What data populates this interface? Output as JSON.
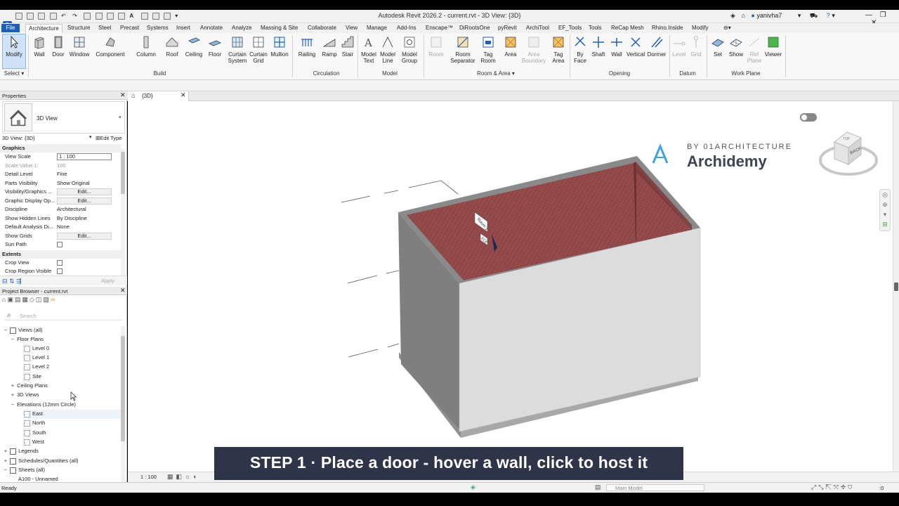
{
  "app": {
    "logo_letter": "R",
    "title": "Autodesk Revit 2026.2 - current.rvt - 3D View: {3D}",
    "user": "yanivha7"
  },
  "menu": {
    "file": "File",
    "tabs": [
      "Architecture",
      "Structure",
      "Steel",
      "Precast",
      "Systems",
      "Insert",
      "Annotate",
      "Analyze",
      "Massing & Site",
      "Collaborate",
      "View",
      "Manage",
      "Add-Ins",
      "Enscape™",
      "DiRootsOne",
      "pyRevit",
      "ArchiTool",
      "EF_Tools",
      "Tools",
      "ReCap Mesh",
      "Rhino.Inside",
      "Modify"
    ],
    "active_tab": "Architecture"
  },
  "ribbon": {
    "select": {
      "modify": "Modify",
      "panel": "Select ▾"
    },
    "build": {
      "items": [
        "Wall",
        "Door",
        "Window",
        "Component",
        "Column",
        "Roof",
        "Ceiling",
        "Floor"
      ],
      "curtain_system": [
        "Curtain",
        "System"
      ],
      "curtain_grid": [
        "Curtain",
        "Grid"
      ],
      "mullion": "Mullion",
      "panel": "Build"
    },
    "circulation": {
      "items": [
        "Railing",
        "Ramp",
        "Stair"
      ],
      "panel": "Circulation"
    },
    "model": {
      "model_text": [
        "Model",
        "Text"
      ],
      "model_line": [
        "Model",
        "Line"
      ],
      "model_group": [
        "Model",
        "Group"
      ],
      "panel": "Model"
    },
    "room_area": {
      "room": "Room",
      "room_separator": [
        "Room",
        "Separator"
      ],
      "tag_room": [
        "Tag",
        "Room"
      ],
      "area": "Area",
      "area_boundary": [
        "Area",
        "Boundary"
      ],
      "tag_area": [
        "Tag",
        "Area"
      ],
      "panel": "Room & Area ▾"
    },
    "opening": {
      "by_face": [
        "By",
        "Face"
      ],
      "items": [
        "Shaft",
        "Wall",
        "Vertical",
        "Dormer"
      ],
      "panel": "Opening"
    },
    "datum": {
      "items": [
        "Level",
        "Grid"
      ],
      "panel": "Datum"
    },
    "work_plane": {
      "items": [
        "Set",
        "Show"
      ],
      "ref_plane": [
        "Ref",
        "Plane"
      ],
      "viewer": "Viewer",
      "panel": "Work Plane"
    }
  },
  "properties": {
    "header": "Properties",
    "type_name": "3D View",
    "instance_label": "3D View: {3D}",
    "edit_type": "Edit Type",
    "sections": {
      "graphics": "Graphics",
      "extents": "Extents"
    },
    "rows": [
      {
        "k": "View Scale",
        "v": "1 : 100"
      },
      {
        "k": "Scale Value    1:",
        "v": "100"
      },
      {
        "k": "Detail Level",
        "v": "Fine"
      },
      {
        "k": "Parts Visibility",
        "v": "Show Original"
      },
      {
        "k": "Visibility/Graphics ...",
        "v": "Edit..."
      },
      {
        "k": "Graphic Display Op...",
        "v": "Edit..."
      },
      {
        "k": "Discipline",
        "v": "Architectural"
      },
      {
        "k": "Show Hidden Lines",
        "v": "By Discipline"
      },
      {
        "k": "Default Analysis Di...",
        "v": "None"
      },
      {
        "k": "Show Grids",
        "v": "Edit..."
      },
      {
        "k": "Sun Path",
        "v": ""
      }
    ],
    "extent_rows": [
      {
        "k": "Crop View"
      },
      {
        "k": "Crop Region Visible"
      }
    ],
    "apply": "Apply"
  },
  "browser": {
    "header": "Project Browser - current.rvt",
    "search_placeholder": "Search",
    "tree": [
      {
        "label": "Views (all)",
        "level": 0,
        "exp": "−"
      },
      {
        "label": "Floor Plans",
        "level": 1,
        "exp": "−"
      },
      {
        "label": "Level 0",
        "level": 2,
        "exp": ""
      },
      {
        "label": "Level 1",
        "level": 2,
        "exp": ""
      },
      {
        "label": "Level 2",
        "level": 2,
        "exp": ""
      },
      {
        "label": "Site",
        "level": 2,
        "exp": ""
      },
      {
        "label": "Ceiling Plans",
        "level": 1,
        "exp": "+"
      },
      {
        "label": "3D Views",
        "level": 1,
        "exp": "+"
      },
      {
        "label": "Elevations (12mm Circle)",
        "level": 1,
        "exp": "−"
      },
      {
        "label": "East",
        "level": 2,
        "exp": ""
      },
      {
        "label": "North",
        "level": 2,
        "exp": ""
      },
      {
        "label": "South",
        "level": 2,
        "exp": ""
      },
      {
        "label": "West",
        "level": 2,
        "exp": ""
      },
      {
        "label": "Legends",
        "level": 0,
        "exp": "+"
      },
      {
        "label": "Schedules/Quantities (all)",
        "level": 0,
        "exp": "+"
      },
      {
        "label": "Sheets (all)",
        "level": 0,
        "exp": "−"
      },
      {
        "label": "A100 - Unnamed",
        "level": 1,
        "exp": ""
      }
    ]
  },
  "view_tab": {
    "label": "{3D}"
  },
  "viewcube": {
    "top": "TOP",
    "back": "BACK"
  },
  "watermark": {
    "by": "BY 01ARCHITECTURE",
    "name": "Archidemy"
  },
  "tag_text": [
    "Room 1",
    "ECE"
  ],
  "viewcontrol": {
    "scale": "1 : 100"
  },
  "status": {
    "ready": "Ready",
    "model": "Main Model",
    "selcount": ":0"
  },
  "caption": "STEP 1  ·  Place a door - hover a wall, click to host it",
  "colors": {
    "accent": "#1f5fb8",
    "floor": "#8a3c3c",
    "caption_bg": "#1c2438"
  }
}
